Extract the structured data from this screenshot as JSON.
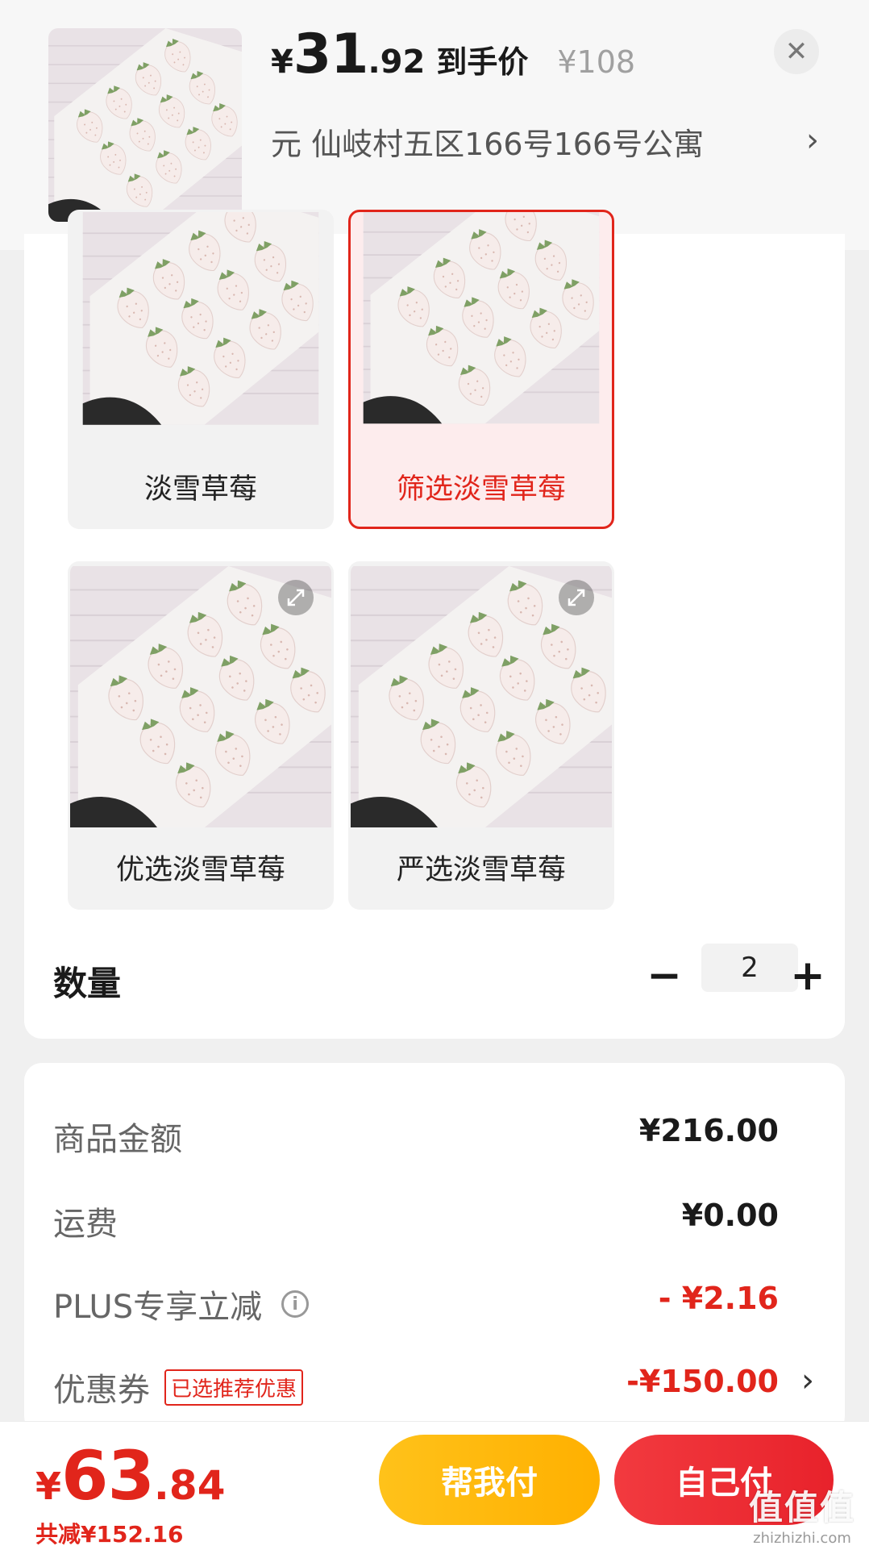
{
  "header": {
    "price_symbol": "¥",
    "price_int": "31",
    "price_dec": ".92",
    "price_tag": "到手价",
    "original_price": "¥108",
    "address": "元  仙岐村五区166号166号公寓",
    "close_icon": "close-icon",
    "chevron_icon": "chevron-right-icon"
  },
  "specs": {
    "items": [
      {
        "label": "淡雪草莓",
        "selected": false
      },
      {
        "label": "筛选淡雪草莓",
        "selected": true
      },
      {
        "label": "优选淡雪草莓",
        "selected": false
      },
      {
        "label": "严选淡雪草莓",
        "selected": false
      }
    ]
  },
  "quantity": {
    "label": "数量",
    "value": "2",
    "minus": "−",
    "plus": "+"
  },
  "details": {
    "goods_amount_label": "商品金额",
    "goods_amount_value": "¥216.00",
    "shipping_label": "运费",
    "shipping_value": "¥0.00",
    "plus_label": "PLUS专享立减",
    "plus_value": "- ¥2.16",
    "coupon_label": "优惠券",
    "coupon_tag": "已选推荐优惠",
    "coupon_value": "-¥150.00"
  },
  "bottom": {
    "total_symbol": "¥",
    "total_int": "63",
    "total_dec": ".84",
    "saved": "共减¥152.16",
    "help_pay": "帮我付",
    "self_pay": "自己付"
  },
  "watermark": {
    "big": "值值值",
    "small": "zhizhizhi.com"
  },
  "colors": {
    "accent_red": "#e1251b",
    "button_yellow": "#ffb800",
    "button_red": "#ec2a32"
  }
}
